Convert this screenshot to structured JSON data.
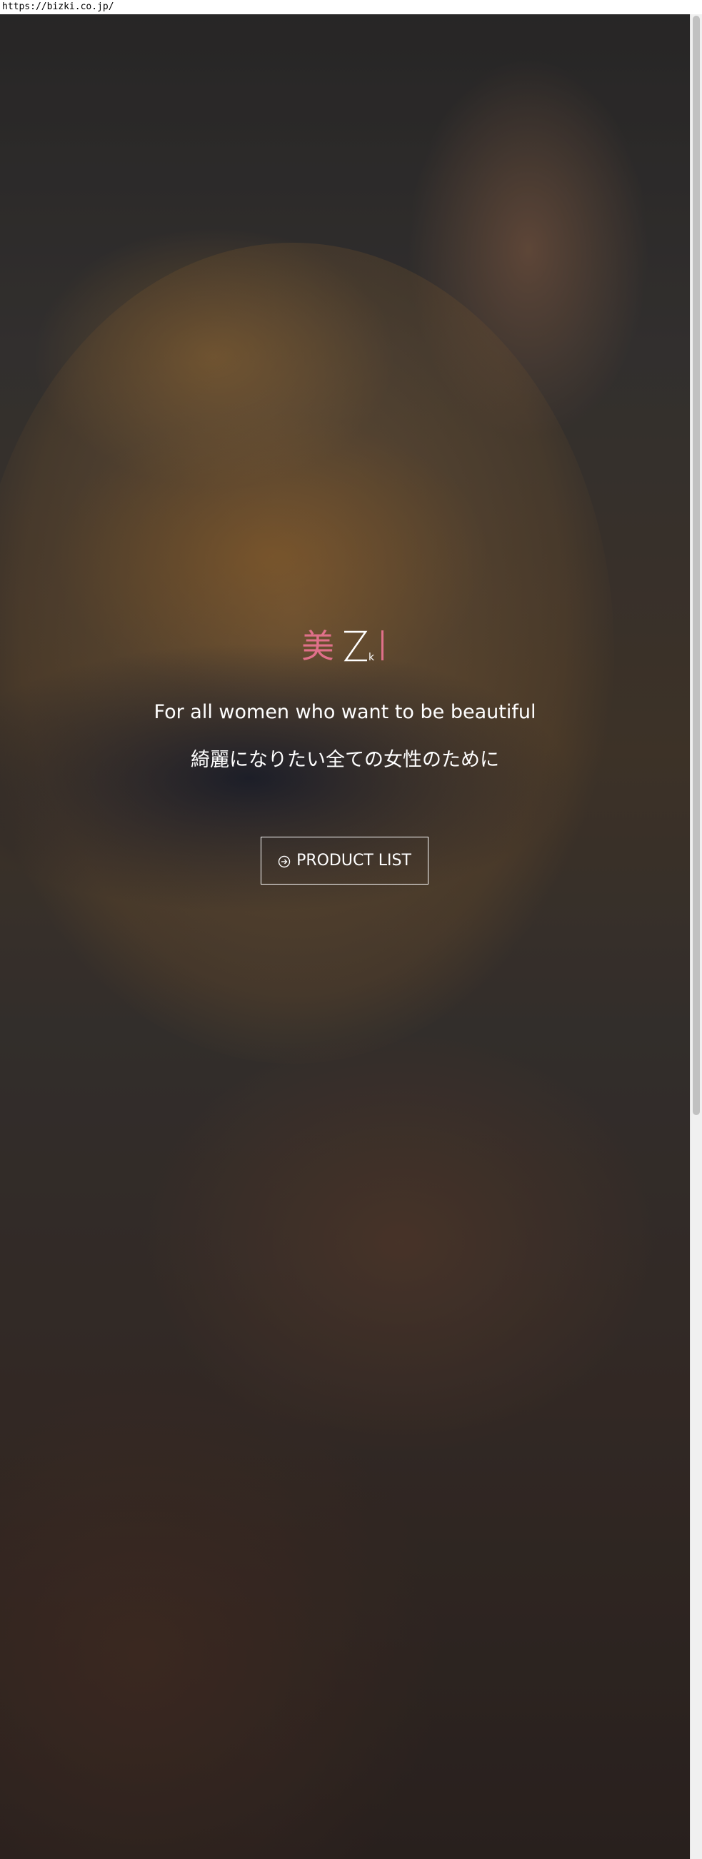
{
  "browser": {
    "url": "https://bizki.co.jp/"
  },
  "hero": {
    "logo": {
      "kanji": "美",
      "latin_z": "Z",
      "latin_k": "k",
      "latin_i": "I",
      "kanji_color": "#e0708a",
      "accent_color": "#e0708a"
    },
    "tagline_en": "For all women who want to be beautiful",
    "tagline_ja": "綺麗になりたい全ての女性のために",
    "product_button": {
      "label": "PRODUCT LIST",
      "icon": "circle-arrow-right-icon"
    }
  },
  "scrollbar": {
    "position_fraction": 0.0
  }
}
